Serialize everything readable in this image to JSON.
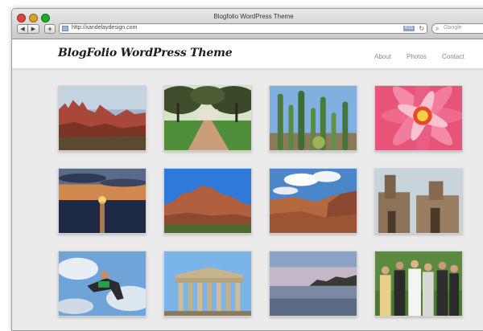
{
  "browser": {
    "window_title": "Blogfolio WordPress Theme",
    "url": "http://xandelaydesign.com",
    "rss_label": "RSS",
    "search_placeholder": "Google",
    "back_icon": "◀",
    "forward_icon": "▶",
    "add_icon": "+",
    "reload_icon": "↻",
    "search_icon": "⌕"
  },
  "site": {
    "title": "BlogFolio WordPress Theme",
    "nav": [
      "About",
      "Photos",
      "Contact"
    ]
  },
  "gallery": {
    "photos": [
      {
        "name": "red-rock-formation-photo"
      },
      {
        "name": "plantation-house-avenue-photo"
      },
      {
        "name": "cactus-garden-photo"
      },
      {
        "name": "pink-dahlia-flower-photo"
      },
      {
        "name": "ocean-sunset-photo"
      },
      {
        "name": "red-canyon-cliff-photo"
      },
      {
        "name": "grand-canyon-clouds-photo"
      },
      {
        "name": "stone-church-photo"
      },
      {
        "name": "athlete-jumping-photo"
      },
      {
        "name": "parthenon-ruins-photo"
      },
      {
        "name": "calm-lake-dusk-photo"
      },
      {
        "name": "wedding-group-photo"
      }
    ]
  }
}
